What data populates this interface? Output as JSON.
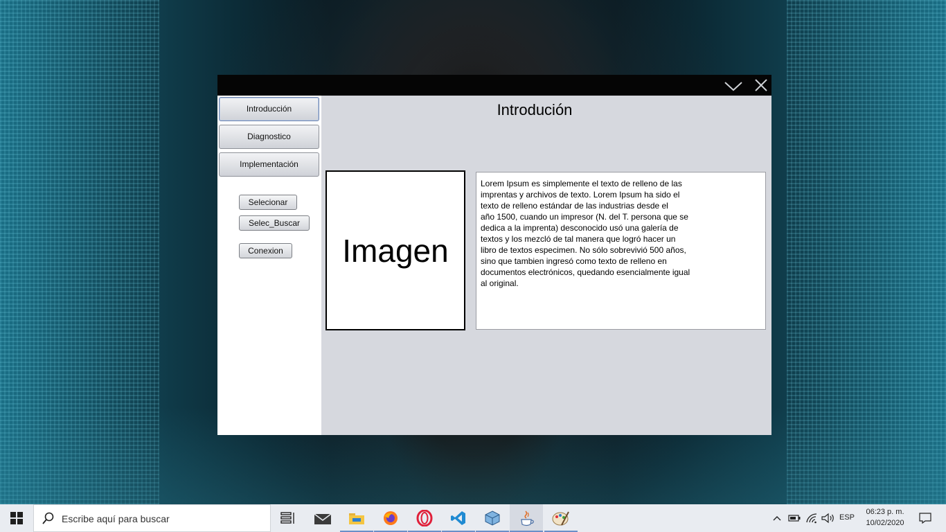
{
  "window": {
    "title": "Introdución",
    "controls": {
      "minimize_icon": "chevron-down-icon",
      "close_icon": "close-icon"
    }
  },
  "sidebar": {
    "nav": [
      {
        "label": "Introducción",
        "active": true
      },
      {
        "label": "Diagnostico",
        "active": false
      },
      {
        "label": "Implementación",
        "active": false
      }
    ],
    "buttons": {
      "selecionar": "Selecionar",
      "selec_buscar": "Selec_Buscar",
      "conexion": "Conexion"
    }
  },
  "main": {
    "image_placeholder": "Imagen",
    "text": "Lorem Ipsum es simplemente el texto de relleno de las\nimprentas y archivos de texto. Lorem Ipsum ha sido el\ntexto de relleno estándar de las industrias desde el\naño 1500, cuando un impresor (N. del T. persona que se\ndedica a la imprenta) desconocido usó una galería de\ntextos y los mezcló de tal manera que logró hacer un\nlibro de textos especimen. No sólo sobrevivió 500 años,\nsino que tambien ingresó como texto de relleno en\ndocumentos electrónicos, quedando esencialmente igual\nal original."
  },
  "taskbar": {
    "search_placeholder": "Escribe aquí para buscar",
    "apps": [
      "task-view-icon",
      "mail-icon",
      "file-explorer-icon",
      "firefox-icon",
      "opera-icon",
      "vscode-icon",
      "box-app-icon",
      "java-icon",
      "paint-icon"
    ],
    "tray": {
      "language": "ESP",
      "time": "06:23 p. m.",
      "date": "10/02/2020"
    }
  },
  "colors": {
    "window_bg": "#d6d8de",
    "titlebar": "#050505",
    "sidebar_bg": "#ffffff",
    "taskbar_bg": "#e9ecf1"
  }
}
